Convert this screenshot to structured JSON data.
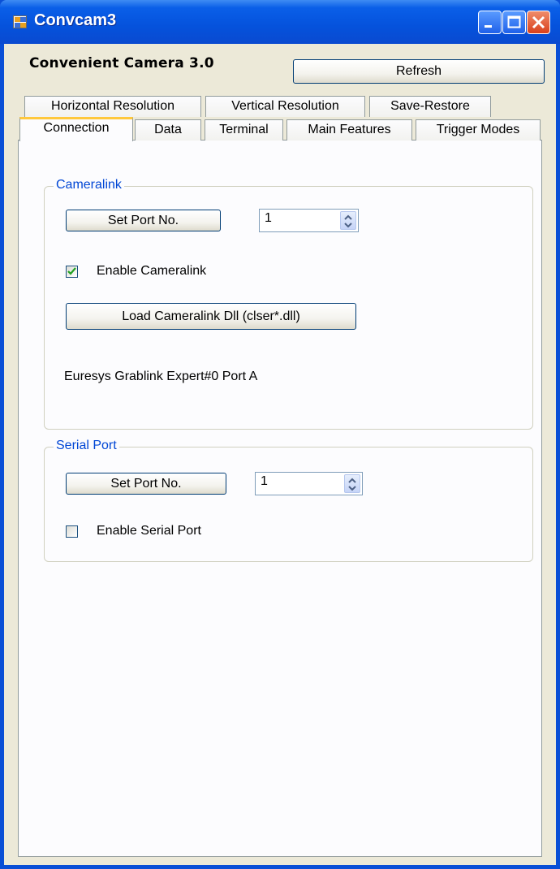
{
  "window": {
    "title": "Convcam3"
  },
  "header": {
    "app_name": "Convenient Camera 3.0",
    "refresh_label": "Refresh"
  },
  "tabs_row1": [
    "Horizontal Resolution",
    "Vertical Resolution",
    "Save-Restore"
  ],
  "tabs_row2": [
    "Connection",
    "Data",
    "Terminal",
    "Main Features",
    "Trigger Modes"
  ],
  "active_tab": "Connection",
  "cameralink": {
    "group_title": "Cameralink",
    "set_port_label": "Set Port No.",
    "port_value": "1",
    "enable_label": "Enable Cameralink",
    "enable_checked": true,
    "load_dll_label": "Load Cameralink Dll (clser*.dll)",
    "status_text": "Euresys Grablink Expert#0 Port A"
  },
  "serial_port": {
    "group_title": "Serial Port",
    "set_port_label": "Set Port No.",
    "port_value": "1",
    "enable_label": "Enable Serial Port",
    "enable_checked": false
  },
  "icons": [
    "app-icon",
    "minimize-icon",
    "maximize-icon",
    "close-icon",
    "spin-up-icon",
    "spin-down-icon",
    "checkmark-icon"
  ],
  "colors": {
    "title_bar": "#0552dc",
    "group_title": "#0046d5",
    "active_tab_accent": "#ffc83c",
    "check_mark": "#21a121"
  }
}
